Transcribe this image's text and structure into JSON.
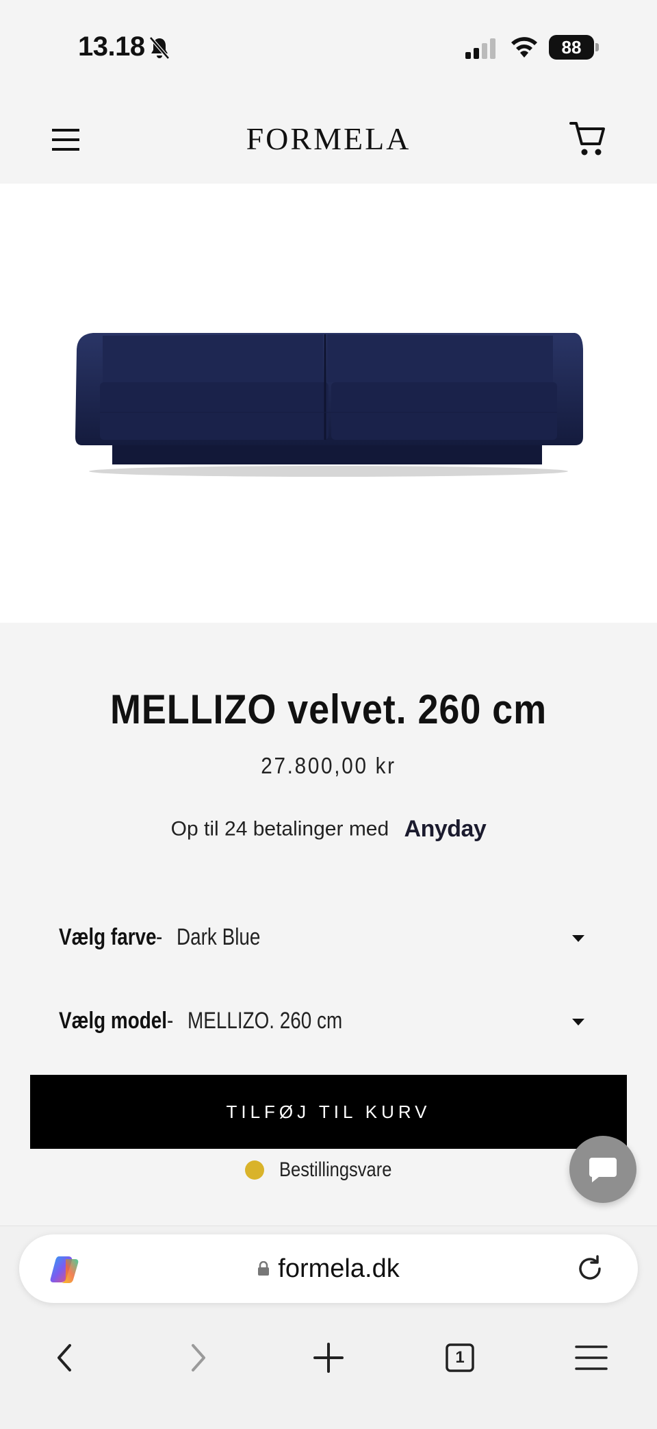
{
  "status_bar": {
    "time": "13.18",
    "battery": "88"
  },
  "header": {
    "logo": "FORMELA",
    "menu_icon": "hamburger-menu-icon",
    "cart_icon": "shopping-cart-icon"
  },
  "product": {
    "image_alt": "sofa-image",
    "title": "MELLIZO velvet. 260 cm",
    "price": "27.800,00 kr",
    "installments_text": "Op til 24 betalinger med",
    "installments_brand": "Anyday",
    "color_label": "Vælg farve",
    "color_value": "Dark Blue",
    "model_label": "Vælg model",
    "model_value": "MELLIZO. 260 cm",
    "separator": "-",
    "add_to_cart": "TILFØJ TIL KURV",
    "availability": "Bestillingsvare",
    "availability_color": "#d9b32a",
    "sofa_color": "#1c2550"
  },
  "browser": {
    "url": "formela.dk",
    "tab_count": "1"
  },
  "colors": {
    "background": "#f4f4f4",
    "button": "#000000",
    "chat_button": "#8f8f8f"
  }
}
